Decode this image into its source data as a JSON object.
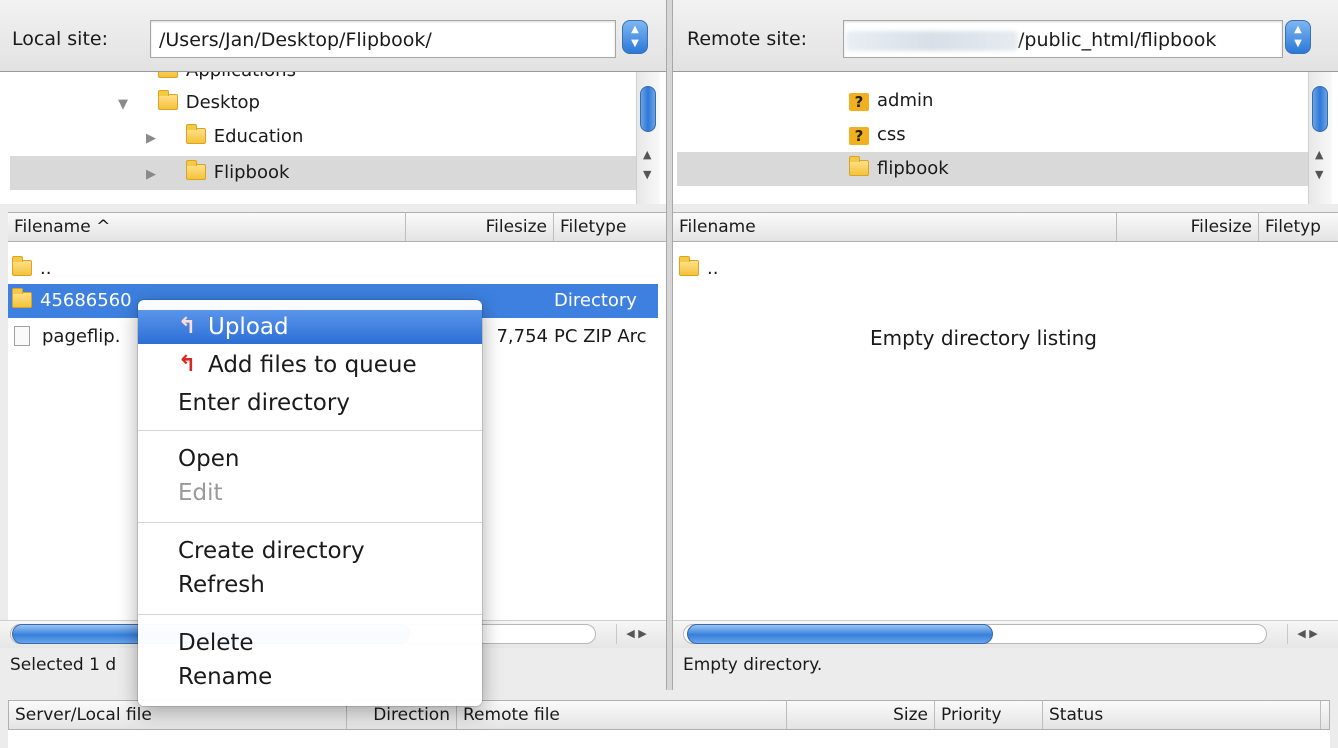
{
  "local": {
    "label": "Local site:",
    "path": "/Users/Jan/Desktop/Flipbook/",
    "tree": [
      {
        "name": "Applications",
        "partial": true
      },
      {
        "name": "Desktop",
        "expanded": true
      },
      {
        "name": "Education"
      },
      {
        "name": "Flipbook",
        "selected": true
      }
    ],
    "columns": {
      "filename": "Filename",
      "filesize": "Filesize",
      "filetype": "Filetype"
    },
    "rows": [
      {
        "name": "..",
        "size": "",
        "type": ""
      },
      {
        "name": "45686560",
        "size": "",
        "type": "Directory",
        "selected": true
      },
      {
        "name": "pageflip.",
        "size": "7,754",
        "type": "PC ZIP Arc"
      }
    ],
    "status": "Selected 1 d"
  },
  "remote": {
    "label": "Remote site:",
    "path": "/public_html/flipbook",
    "tree": [
      {
        "name": "admin",
        "unknown": true
      },
      {
        "name": "css",
        "unknown": true
      },
      {
        "name": "flipbook",
        "selected": true
      }
    ],
    "columns": {
      "filename": "Filename",
      "filesize": "Filesize",
      "filetype": "Filetyp"
    },
    "rows": [
      {
        "name": ".."
      }
    ],
    "empty_message": "Empty directory listing",
    "status": "Empty directory."
  },
  "queue": {
    "columns": {
      "server_local": "Server/Local file",
      "direction": "Direction",
      "remote_file": "Remote file",
      "size": "Size",
      "priority": "Priority",
      "status": "Status"
    }
  },
  "context_menu": {
    "items": {
      "upload": "Upload",
      "add_to_queue": "Add files to queue",
      "enter_directory": "Enter directory",
      "open": "Open",
      "edit": "Edit",
      "create_directory": "Create directory",
      "refresh": "Refresh",
      "delete": "Delete",
      "rename": "Rename"
    }
  },
  "icons": {
    "folder": "folder-icon",
    "unknown_folder": "question-folder-icon",
    "file": "file-icon",
    "upload": "upload-arrow-icon",
    "sort": "sort-ascending-icon",
    "stepper": "stepper-icon"
  },
  "colors": {
    "selection": "#3d80df",
    "menu_highlight": "#2c6fd6",
    "folder": "#f4c23c"
  }
}
